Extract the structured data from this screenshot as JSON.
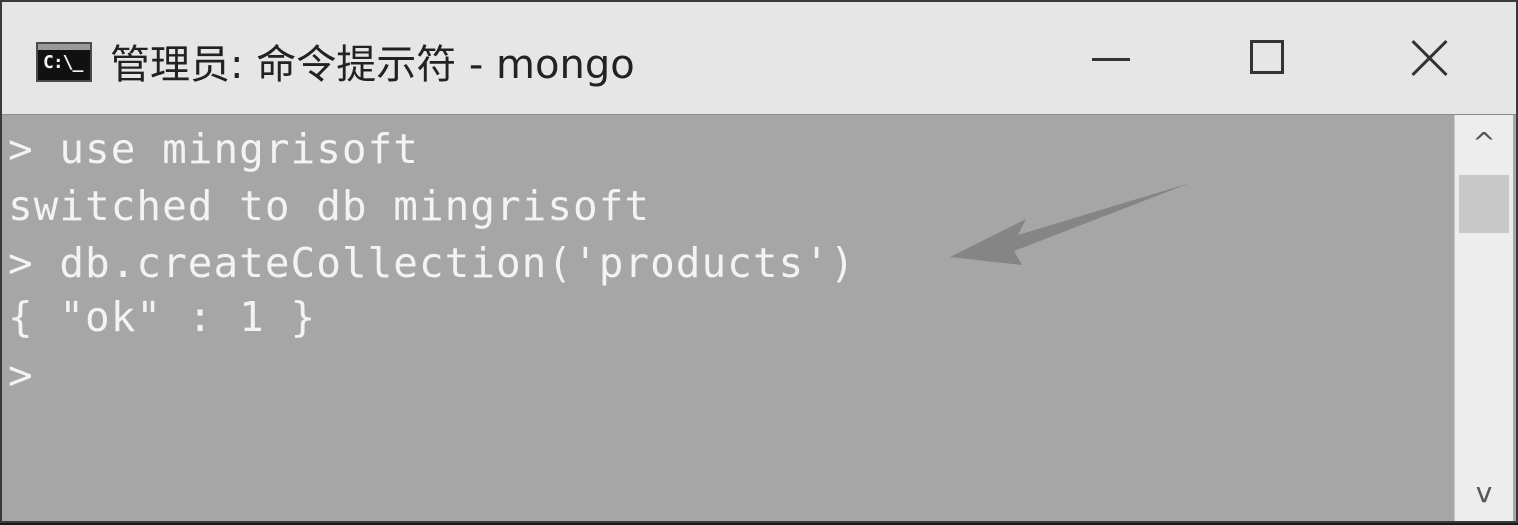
{
  "window": {
    "title": "管理员: 命令提示符 - mongo",
    "icon": "cmd-icon",
    "icon_glyph": "C:\\_",
    "controls": {
      "minimize": "minimize-icon",
      "maximize": "maximize-icon",
      "close": "close-icon"
    }
  },
  "console": {
    "lines": [
      "> use mingrisoft",
      "switched to db mingrisoft",
      "> db.createCollection('products')",
      "{ \"ok\" : 1 }",
      ">"
    ],
    "annotation": "arrow pointing at createCollection line"
  },
  "scrollbar": {
    "up_icon": "chevron-up-icon",
    "down_icon": "chevron-down-icon",
    "up_glyph": "^",
    "down_glyph": "v"
  },
  "colors": {
    "titlebar_bg": "#e6e6e6",
    "console_bg": "#a6a6a6",
    "console_text": "#f3f3f3"
  }
}
